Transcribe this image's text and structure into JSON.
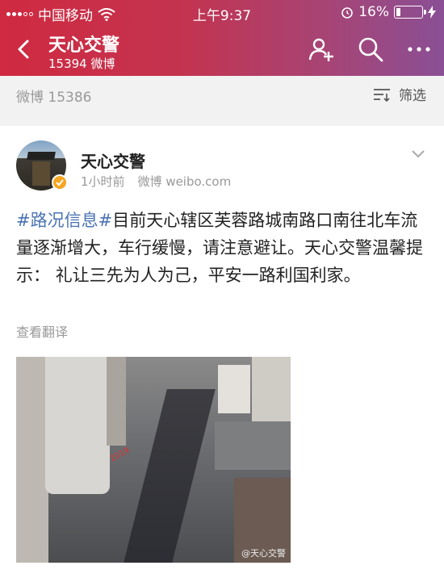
{
  "status_bar": {
    "carrier": "中国移动",
    "time": "上午9:37",
    "battery": "16%",
    "battery_level": 0.16
  },
  "nav": {
    "title": "天心交警",
    "subtitle": "15394 微博"
  },
  "filter_row": {
    "count": "微博 15386",
    "filter_label": "筛选"
  },
  "post": {
    "author": "天心交警",
    "time": "1小时前",
    "source": "微博 weibo.com",
    "topic": "#路况信息#",
    "body": "目前天心辖区芙蓉路城南路口南往北车流量逐渐增大，车行缓慢，请注意避让。天心交警温馨提示： 礼让三先为人为己，平安一路利国利家。",
    "translate": "查看翻译",
    "image_watermark": "@天心交警"
  },
  "colors": {
    "header_gradient_start": "#cf2a41",
    "header_gradient_end": "#8a4f95",
    "topic_link": "#4b73b3",
    "verified_badge": "#f5a623"
  }
}
